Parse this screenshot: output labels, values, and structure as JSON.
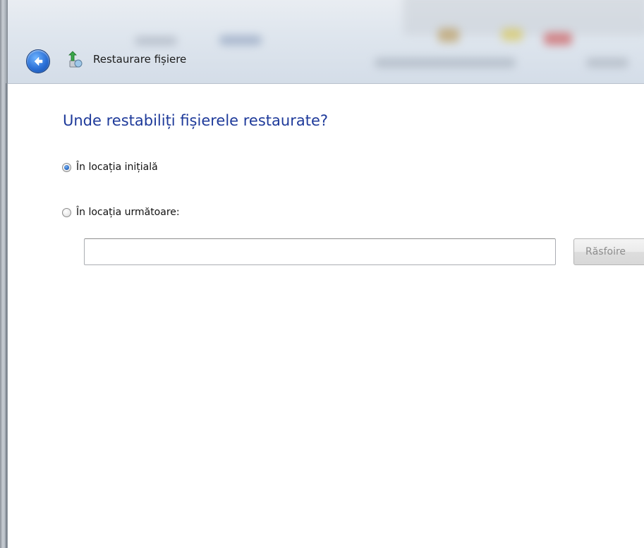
{
  "window": {
    "title": "Restaurare fișiere"
  },
  "icons": {
    "back": "back-arrow-icon",
    "app": "restore-files-icon"
  },
  "main": {
    "heading": "Unde restabiliți fișierele restaurate?",
    "options": [
      {
        "label": "În locația inițială",
        "selected": true
      },
      {
        "label": "În locația următoare:",
        "selected": false
      }
    ],
    "location_input": {
      "value": "",
      "placeholder": ""
    },
    "browse_label": "Răsfoire",
    "browse_enabled": false
  },
  "colors": {
    "heading": "#1e3a9a",
    "back_button": "#2a6fd6"
  }
}
